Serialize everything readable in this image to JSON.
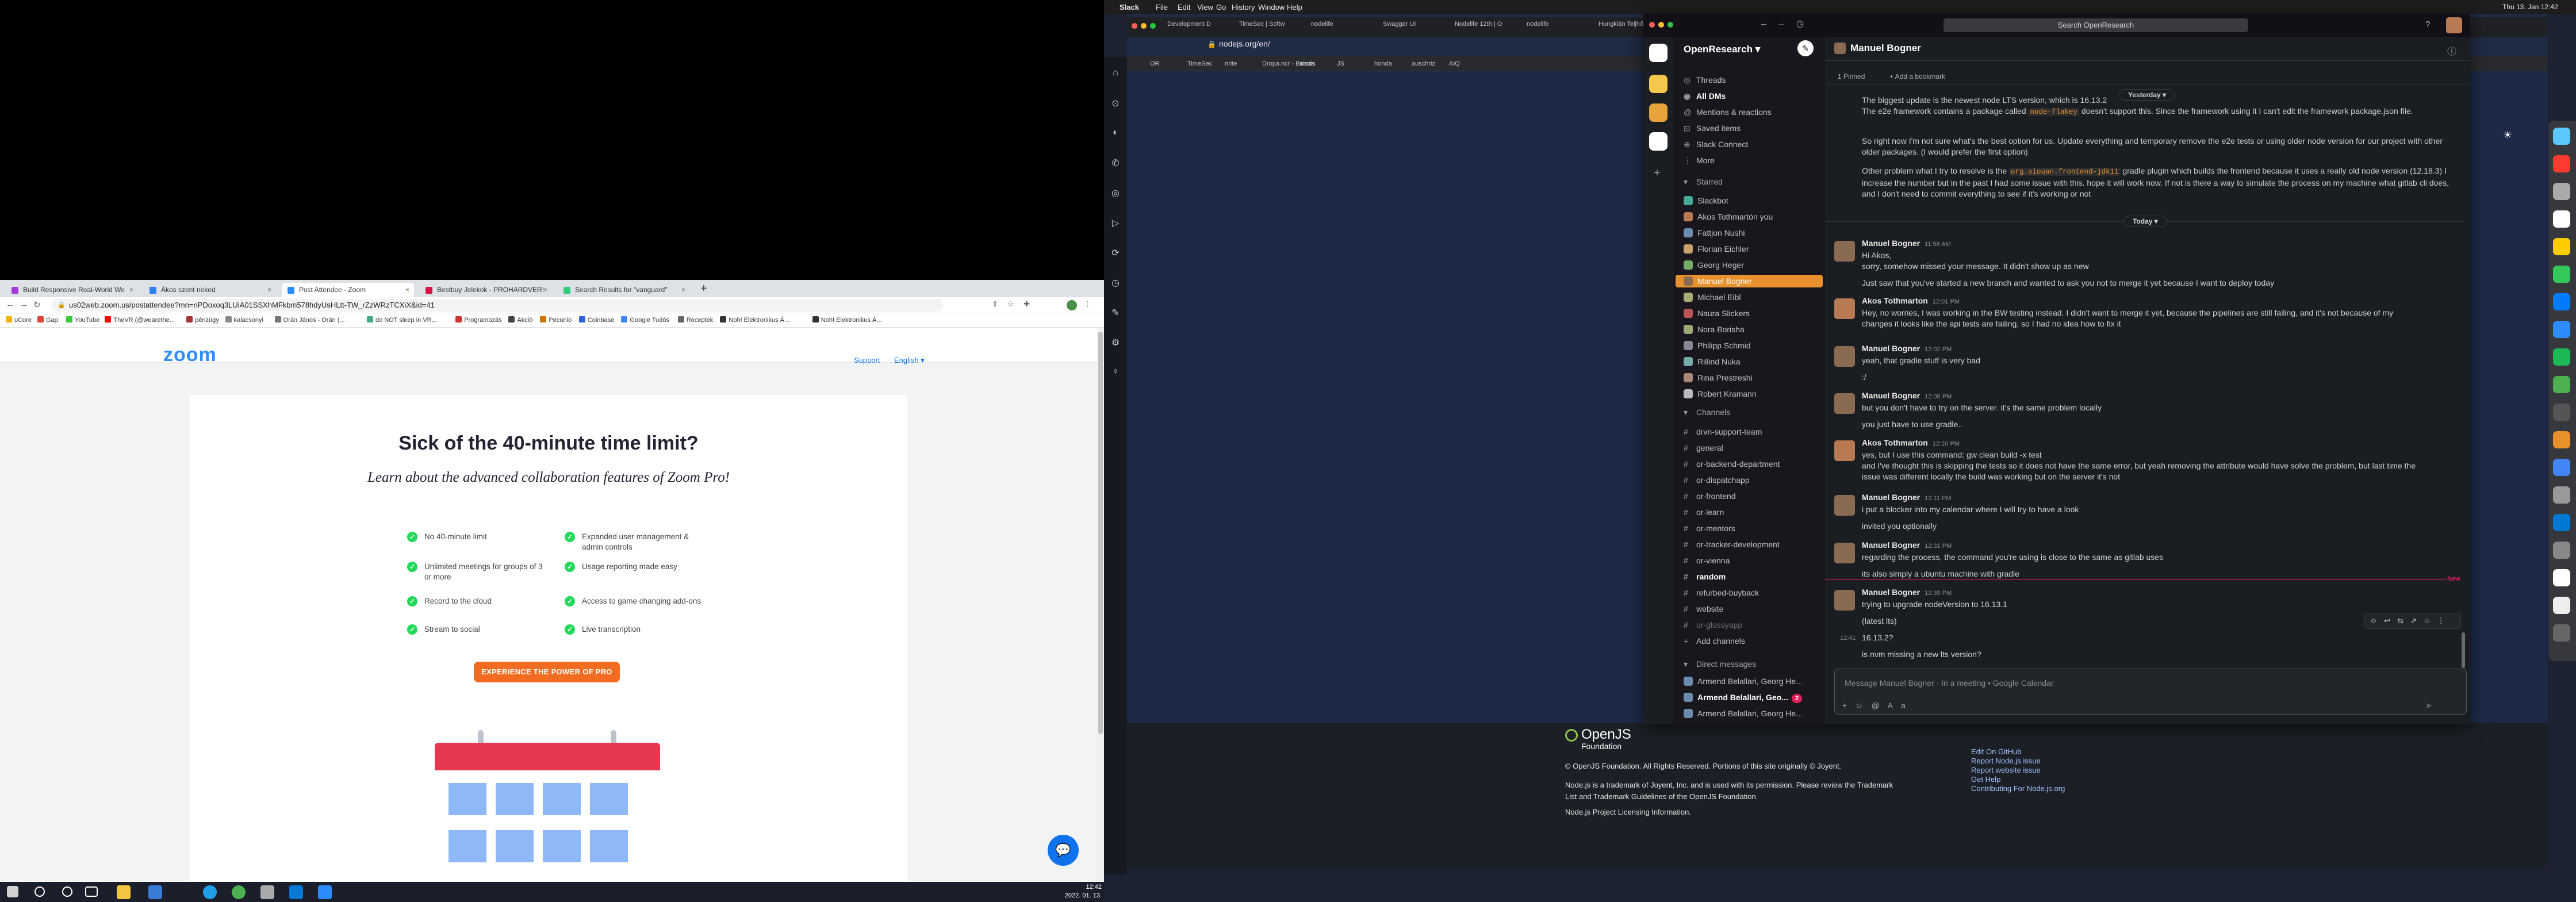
{
  "left": {
    "tabs": [
      {
        "label": "Build Responsive Real-World We",
        "color": "#a53bd8"
      },
      {
        "label": "Ákos szent neked",
        "color": "#2d7ff9"
      },
      {
        "label": "Post Attendee - Zoom",
        "color": "#2d8cff"
      },
      {
        "label": "Bestbuy Jelekok - PROHARDVER!",
        "color": "#d14"
      },
      {
        "label": "Search Results for \"vanguard\"",
        "color": "#3c7"
      }
    ],
    "url": "us02web.zoom.us/postattendee?mn=nPDoxoq3LUiA01SSXhMFkbm578hdyUsHLtt-TW_rZzWRzTCXiX&id=41",
    "bookmarks": [
      "uCore",
      "Gap",
      "YouTube",
      "TheVR (@wearethe...",
      "pénzügy",
      "kalacsonyi",
      "Orán János - Orán (...",
      "do NOT sleep in VR...",
      "Programozás",
      "Akció",
      "Pecunio",
      "Coinbase",
      "Google Tudós",
      "Receptek",
      "Noh! Elektronikus Á...",
      "Noh! Elektronikus Á..."
    ],
    "zoom": {
      "logo": "zoom",
      "support": "Support",
      "language": "English ▾",
      "title": "Sick of the 40-minute time limit?",
      "subtitle": "Learn about the advanced collaboration features of Zoom Pro!",
      "features_left": [
        "No 40-minute limit",
        "Unlimited meetings for groups of 3 or more",
        "Record to the cloud",
        "Stream to social"
      ],
      "features_right": [
        "Expanded user management & admin controls",
        "Usage reporting made easy",
        "Access to game changing add-ons",
        "Live transcription"
      ],
      "cta": "EXPERIENCE THE POWER OF PRO"
    },
    "clock": {
      "time": "12:42",
      "date": "2022. 01. 13."
    }
  },
  "mac": {
    "menu": [
      "Slack",
      "File",
      "Edit",
      "View",
      "Go",
      "History",
      "Window",
      "Help"
    ],
    "clock": "Thu 13. Jan 12:42"
  },
  "chrome_right": {
    "tabs": [
      "Development D",
      "TimeSec | Softw",
      "nodelife",
      "Swagger UI",
      "Nodelife 12th | O",
      "nodelife",
      "Hungkián Teljhő"
    ],
    "url": "nodejs.org/en/",
    "bookmarks": [
      "OR",
      "TimeSec",
      "nrite",
      "Dropa.ncr - Boards",
      "ideas",
      "JS",
      "honda",
      "auschriz",
      "AIQ"
    ],
    "footer": {
      "openjs": "OpenJS",
      "foundation": "Foundation",
      "copy": "© OpenJS Foundation. All Rights Reserved. Portions of this site originally © Joyent.",
      "tm1": "Node.js is a trademark of Joyent, Inc. and is used with its permission. Please review the Trademark",
      "tm2": "List and Trademark Guidelines of the OpenJS Foundation.",
      "lic": "Node.js Project Licensing Information.",
      "links": [
        "Edit On GitHub",
        "Report Node.js issue",
        "Report website issue",
        "Get Help",
        "Contributing For Node.js.org"
      ]
    }
  },
  "slack": {
    "search": "Search OpenResearch",
    "workspace": "OpenResearch ▾",
    "nav": [
      "Threads",
      "All DMs",
      "Mentions & reactions",
      "Saved items",
      "Slack Connect",
      "More"
    ],
    "starred_label": "Starred",
    "starred": [
      "Slackbot",
      "Akos Tothmartón  you",
      "Fattjon Nushi",
      "Florian Eichler",
      "Georg Heger",
      "Manuel Bogner",
      "Michael Eibl",
      "Naura Slickers",
      "Nora Borisha",
      "Philipp Schmid",
      "Rillind Nuka",
      "Rina Prestreshi",
      "Robert Kramann"
    ],
    "channels_label": "Channels",
    "channels": [
      "drvn-support-team",
      "general",
      "or-backend-department",
      "or-dispatchapp",
      "or-frontend",
      "or-learn",
      "or-mentors",
      "or-tracker-development",
      "or-vienna",
      "random",
      "refurbed-buyback",
      "website",
      "or-glossyapp"
    ],
    "add_channels": "Add channels",
    "dm_label": "Direct messages",
    "dms": [
      "Armend Belallari, Georg He...",
      "Armend Belallari, Geo...",
      "Armend Belallari, Georg He..."
    ],
    "dm_badge": "2",
    "channel": "Manuel Bogner",
    "pinned": "1 Pinned",
    "add_bookmark": "+ Add a bookmark",
    "top_lines": [
      "The biggest update is the newest node LTS version, which is 16.13.2",
      "The e2e framework contains a package called",
      "doesn't support this. Since the framework using it I can't edit the framework package.json file.",
      "So right now I'm not sure what's the best option for us. Update everything and temporary remove the e2e tests or using older node version for our project with other older packages. (I would prefer the first option)",
      "Other problem what I try to resolve is the",
      "gradle plugin which builds the frontend because it uses a really old node version (12.18.3) I increase the number but in the past I had some issue with this. hope it will work now. If not is there a way to simulate the process on my machine what gitlab cli does, and I don't need to commit everything to see if it's working or not"
    ],
    "code_flakey": "node-flakey",
    "code_frontend": "org.siouan.frontend-jdk11",
    "yesterday": "Yesterday ▾",
    "today": "Today ▾",
    "new_label": "New",
    "messages": [
      {
        "who": "Manuel Bogner",
        "time": "11:56 AM",
        "lines": [
          "Hi Akos,",
          "sorry, somehow missed your message. It didn't show up as new",
          "Just saw that you've started a new branch and wanted to ask you not to merge it yet because I want to deploy today"
        ]
      },
      {
        "who": "Akos Tothmarton",
        "time": "12:01 PM",
        "lines": [
          "Hey, no worries, I was working in the BW testing instead. I didn't want to merge it yet, because the pipelines are still failing, and it's not because of my",
          "changes it looks like the api tests are failing, so I had no idea how to fix it"
        ]
      },
      {
        "who": "Manuel Bogner",
        "time": "12:02 PM",
        "lines": [
          "yeah, that gradle stuff is very bad",
          ":/"
        ]
      },
      {
        "who": "Manuel Bogner",
        "time": "12:08 PM",
        "lines": [
          "but you don't have to try on the server. it's the same problem locally",
          "you just have to use gradle.."
        ]
      },
      {
        "who": "Akos Tothmarton",
        "time": "12:10 PM",
        "lines": [
          "yes, but I use this command: gw clean build -x test",
          "and I've thought this is skipping the tests so it does not have the same error, but yeah removing the attribute would have solve the problem, but last time the",
          "issue was different locally the build was working but on the server it's not"
        ]
      },
      {
        "who": "Manuel Bogner",
        "time": "12:11 PM",
        "lines": [
          "i put a blocker into my calendar where I will try to have a look",
          "invited you optionally"
        ]
      },
      {
        "who": "Manuel Bogner",
        "time": "12:31 PM",
        "lines": [
          "regarding the process, the command you're using is close to the same as gitlab uses",
          "its also simply a ubuntu machine with gradle"
        ]
      },
      {
        "who": "Manuel Bogner",
        "time": "12:39 PM",
        "lines": [
          "trying to upgrade nodeVersion to 16.13.1",
          "(latest lts)",
          "16.13.2?",
          "is nvm missing a new lts version?"
        ]
      }
    ],
    "hover_time": "12:41",
    "composer_placeholder": "Message Manuel Bogner  ·  In a meeting • Google Calendar"
  }
}
